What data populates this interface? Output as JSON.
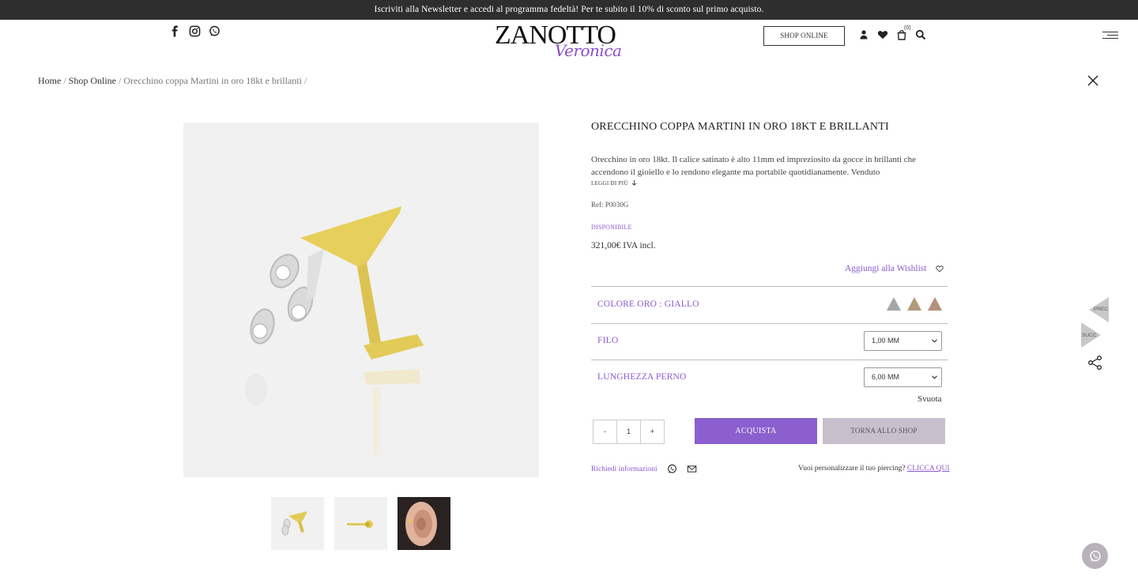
{
  "topbar": {
    "text": "Iscriviti alla Newsletter e accedi al programma fedeltà! Per te subito il 10% di sconto sul primo acquisto."
  },
  "header": {
    "logo_main": "ZANOTTO",
    "logo_sub": "Veronica",
    "shop_online_label": "SHOP ONLINE",
    "cart_count": "(0)"
  },
  "breadcrumb": {
    "home": "Home",
    "shop": "Shop Online",
    "current": "Orecchino coppa Martini in oro 18kt e brillanti"
  },
  "product": {
    "title": "ORECCHINO COPPA MARTINI IN ORO 18KT E BRILLANTI",
    "description": "Orecchino in oro 18kt. Il calice satinato è alto 11mm ed impreziosito da gocce in brillanti che accendono il gioiello e lo rendono elegante ma portabile quotidianamente. Venduto",
    "read_more": "LEGGI DI PIÙ",
    "ref": "Ref: P0030G",
    "availability": "DISPONIBILE",
    "price": "321,00€ IVA incl.",
    "wishlist": "Aggiungi alla Wishlist"
  },
  "options": {
    "color_label": "COLORE ORO : GIALLO",
    "swatches": [
      "#a6a6a6",
      "#b09a7a",
      "#b5907a"
    ],
    "filo_label": "FILO",
    "filo_value": "1,00 MM",
    "perno_label": "LUNGHEZZA PERNO",
    "perno_value": "6,00 MM",
    "clear": "Svuota"
  },
  "cart": {
    "minus": "-",
    "qty": "1",
    "plus": "+",
    "buy": "ACQUISTA",
    "back": "TORNA ALLO SHOP"
  },
  "info": {
    "request": "Richiedi informazioni",
    "custom_text": "Vuoi personalizzare il tuo piercing?",
    "custom_link": "CLICCA QUI"
  },
  "side_nav": {
    "prev": "PREC",
    "next": "SUCC"
  }
}
